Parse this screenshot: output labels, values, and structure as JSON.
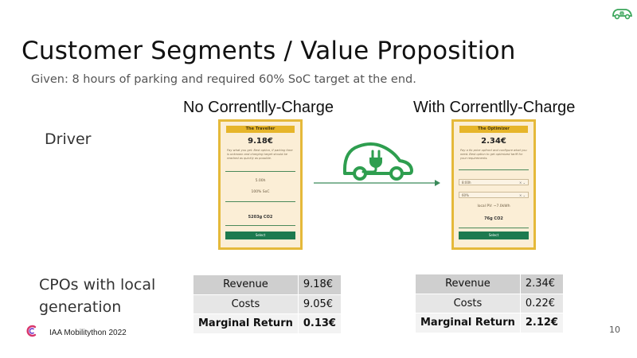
{
  "slide": {
    "title": "Customer Segments / Value Proposition",
    "subtitle": "Given: 8 hours of parking and required 60% SoC target at the end.",
    "page_number": "10",
    "footer": "IAA Mobilitython 2022"
  },
  "columns": {
    "left_header": "No Correntlly-Charge",
    "right_header": "With Correntlly-Charge"
  },
  "rows": {
    "driver_label": "Driver",
    "cpo_label_line1": "CPOs with local",
    "cpo_label_line2": "generation"
  },
  "phone_left": {
    "header": "The Traveller",
    "price": "9.18€",
    "description": "Pay what you get. Best option, if parking time is unknown and charging target should be reached as quickly as possible.",
    "time": "5.00h",
    "soc": "100% SoC",
    "co2": "5203g CO2",
    "button": "Select"
  },
  "phone_right": {
    "header": "The Optimizer",
    "price": "2.34€",
    "description": "Pay a fix price upfront and configure what you need. Best option to get optimized tariff for your requirements.",
    "field1": "8:00h",
    "field2": "60%",
    "local_pv": "local PV: ~7.0kWh",
    "co2": "76g CO2",
    "button": "Select"
  },
  "table_left": [
    {
      "label": "Revenue",
      "value": "9.18€"
    },
    {
      "label": "Costs",
      "value": "9.05€"
    },
    {
      "label": "Marginal Return",
      "value": "0.13€"
    }
  ],
  "table_right": [
    {
      "label": "Revenue",
      "value": "2.34€"
    },
    {
      "label": "Costs",
      "value": "0.22€"
    },
    {
      "label": "Marginal Return",
      "value": "2.12€"
    }
  ],
  "colors": {
    "accent_yellow": "#e6b52a",
    "green": "#2e9e4f",
    "button_green": "#1d7a4f"
  },
  "icons": {
    "top_logo": "car-plug-icon",
    "center_icon": "ev-car-plug-icon",
    "footer_logo": "correntlly-logo-icon"
  }
}
